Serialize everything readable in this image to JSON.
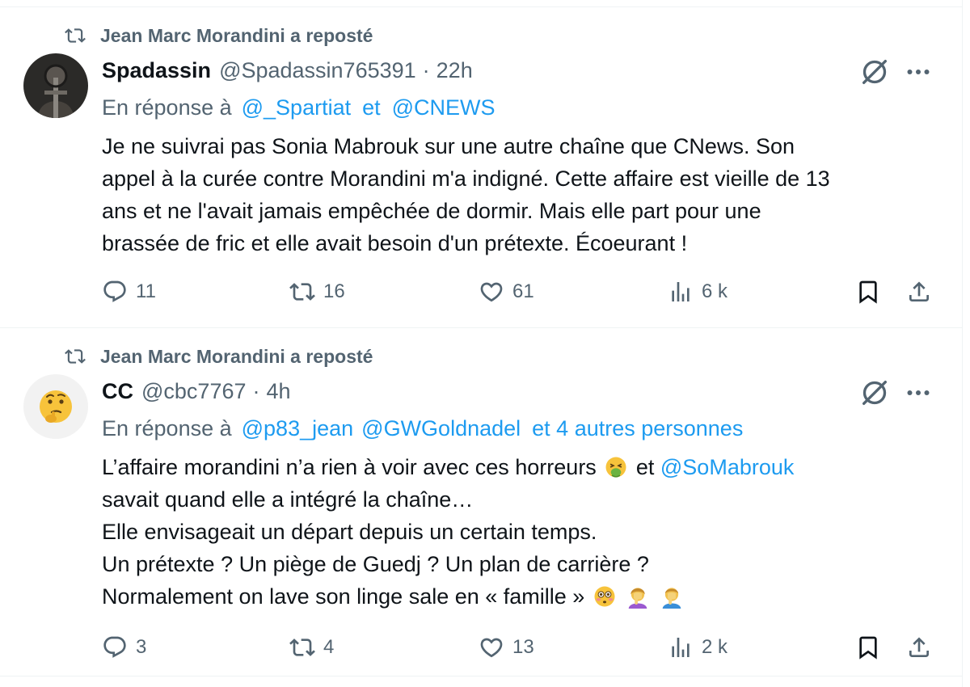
{
  "tweets": [
    {
      "repost_label": "Jean Marc Morandini a reposté",
      "display_name": "Spadassin",
      "handle": "@Spadassin765391",
      "separator": "·",
      "time": "22h",
      "reply_prefix": "En réponse à",
      "reply_mentions": [
        "@_Spartiat",
        "et",
        "@CNEWS"
      ],
      "lines": [
        "Je ne suivrai pas Sonia Mabrouk sur une autre chaîne que CNews. Son",
        "appel à la curée contre Morandini m'a indigné. Cette affaire est vieille de 13",
        "ans et ne l'avait jamais empêchée de dormir. Mais elle part pour une",
        "brassée de fric et elle avait besoin d'un prétexte. Écoeurant !"
      ],
      "replies": "11",
      "reposts": "16",
      "likes": "61",
      "views": "6 k"
    },
    {
      "repost_label": "Jean Marc Morandini a reposté",
      "display_name": "CC",
      "handle": "@cbc7767",
      "separator": "·",
      "time": "4h",
      "reply_prefix": "En réponse à",
      "reply_mentions": [
        "@p83_jean",
        "@GWGoldnadel",
        "et 4 autres personnes"
      ],
      "line1_text": "L’affaire morandini n’a rien à voir avec ces horreurs",
      "line1_mid": "et",
      "line1_mention": "@SoMabrouk",
      "lines": [
        "savait quand elle a intégré la chaîne…",
        "Elle envisageait un départ depuis un certain temps.",
        "Un prétexte ? Un piège de Guedj ? Un plan de carrière ?"
      ],
      "last_line": "Normalement on lave son linge sale en « famille »",
      "replies": "3",
      "reposts": "4",
      "likes": "13",
      "views": "2 k"
    }
  ],
  "icons": {
    "repost": "repost-icon",
    "grok": "grok-icon",
    "more": "more-icon",
    "reply": "reply-icon",
    "like": "heart-icon",
    "views": "views-icon",
    "bookmark": "bookmark-icon",
    "share": "share-icon"
  },
  "colors": {
    "link": "#1d9bf0",
    "secondary": "#536471",
    "text": "#0f1419",
    "divider": "#eff3f4"
  }
}
